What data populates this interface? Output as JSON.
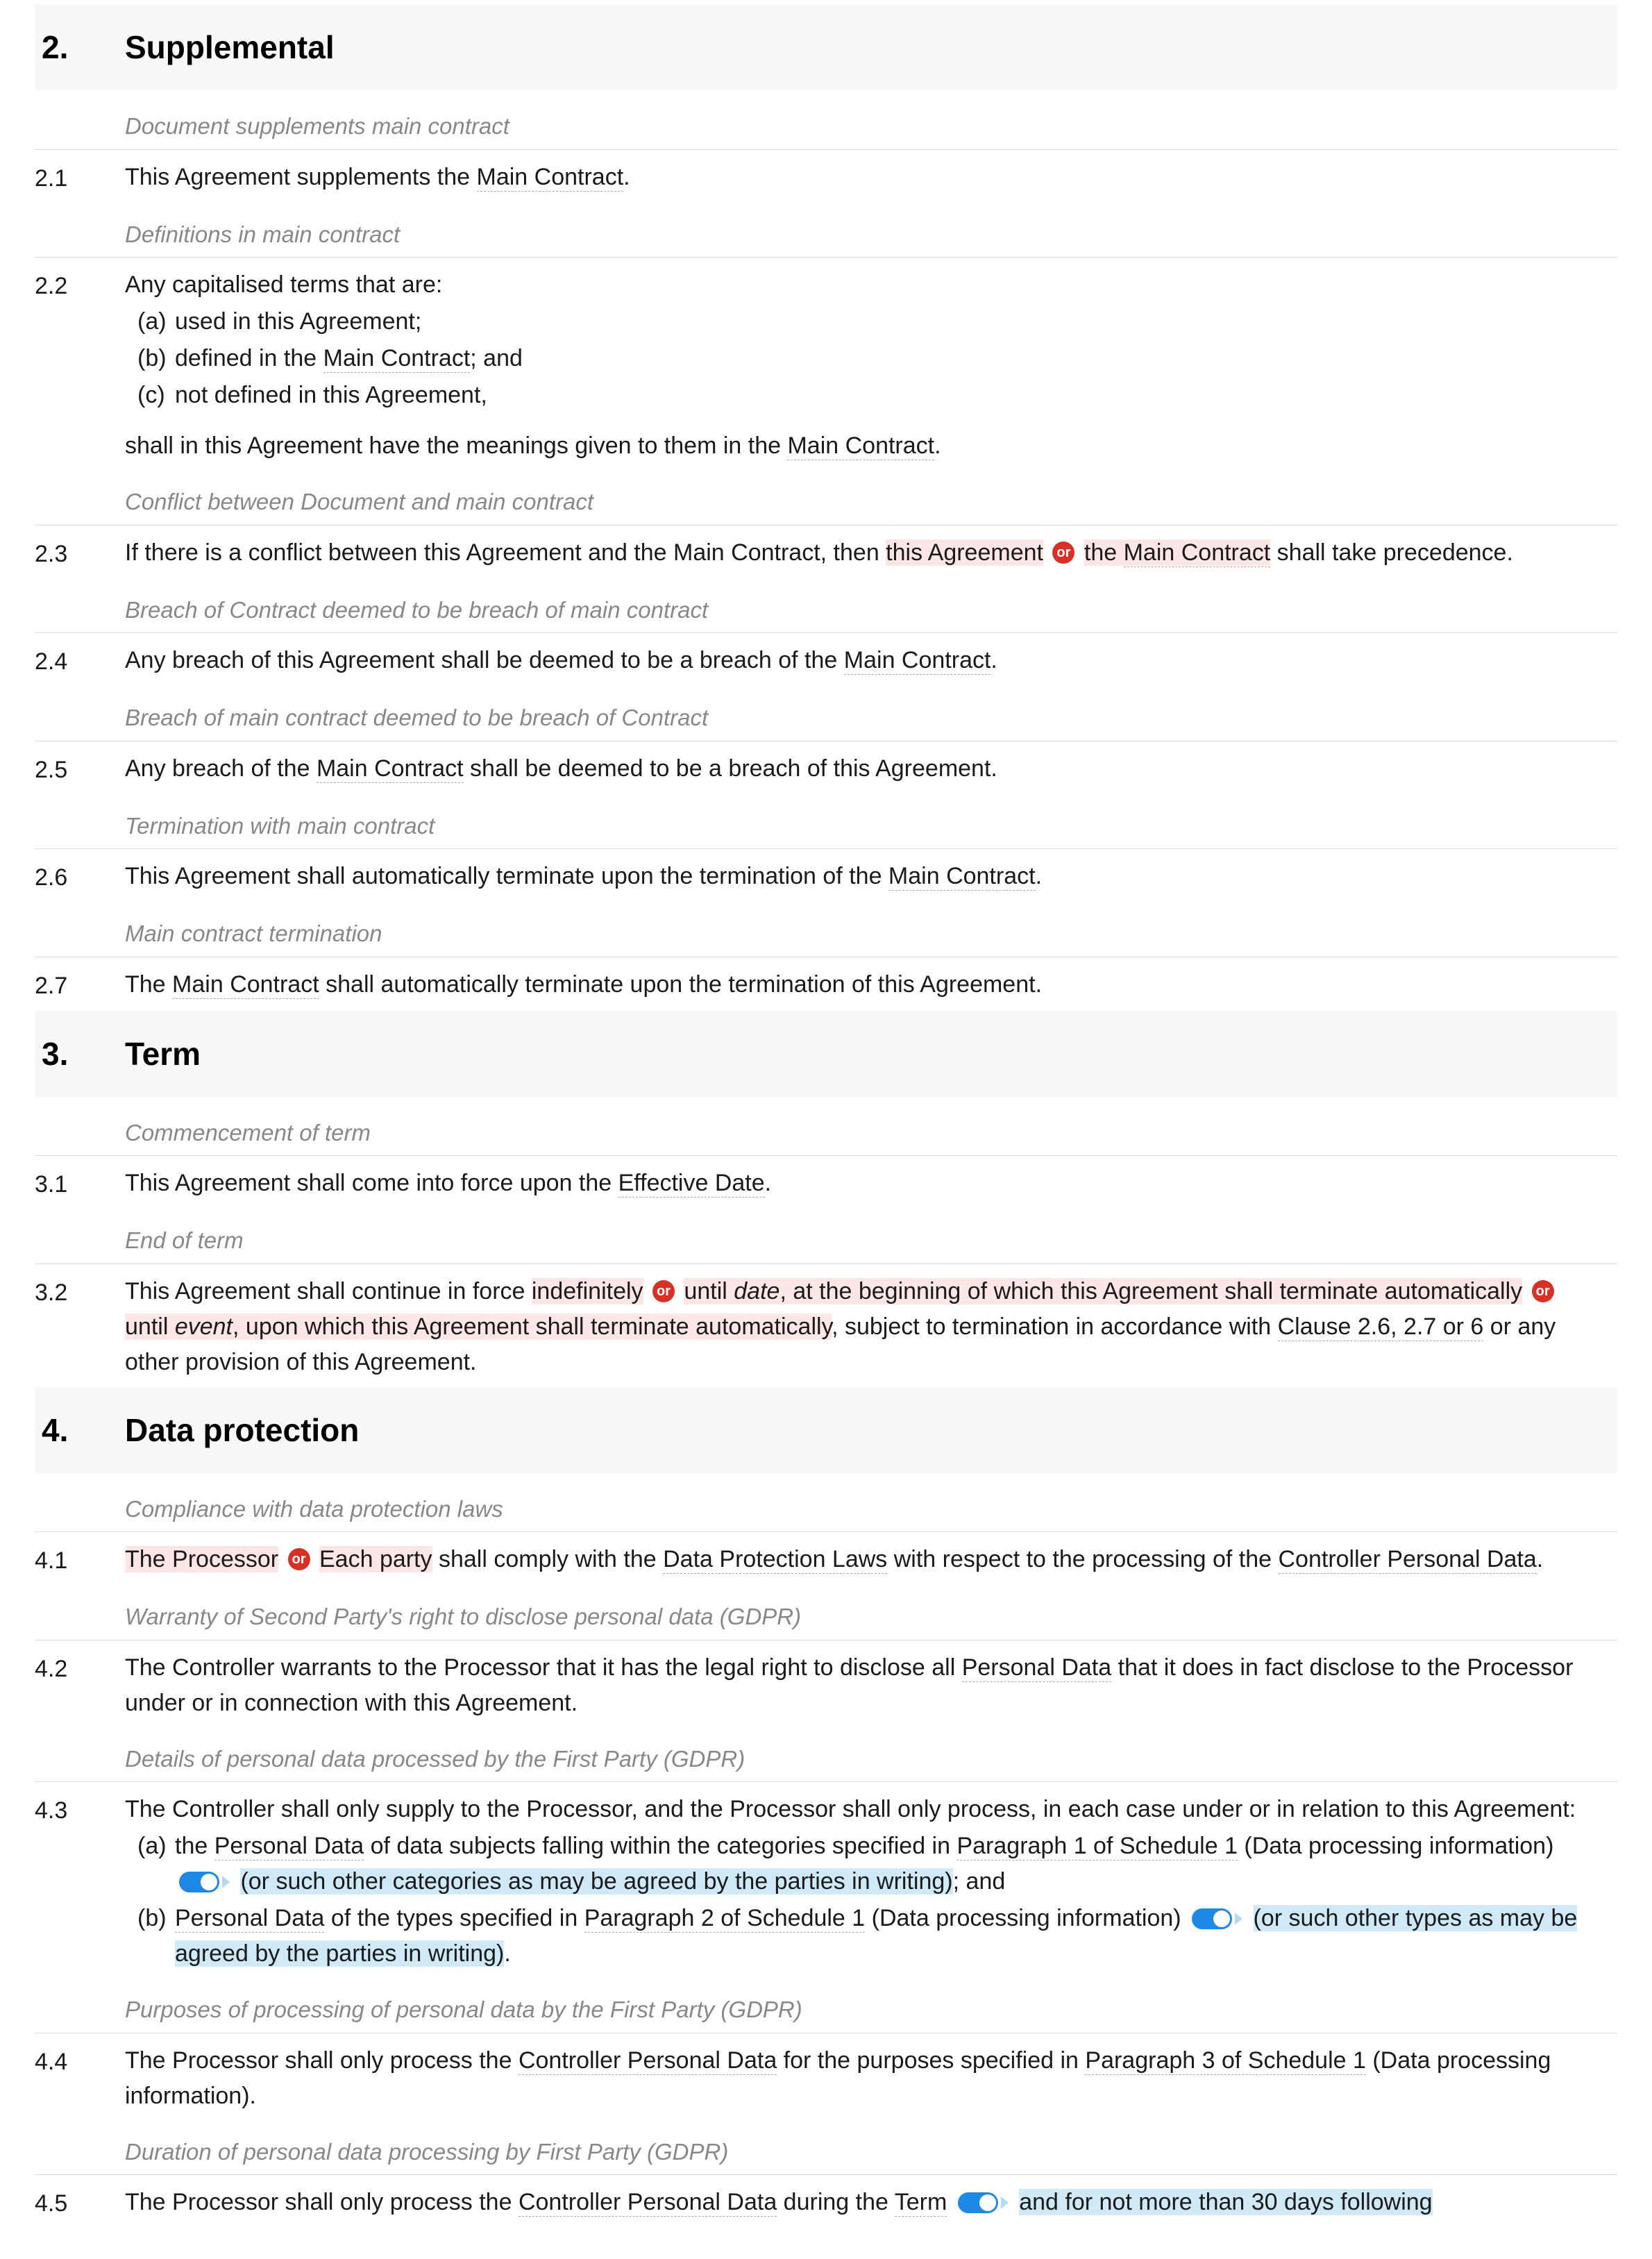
{
  "sections": {
    "s2": {
      "num": "2.",
      "title": "Supplemental"
    },
    "s3": {
      "num": "3.",
      "title": "Term"
    },
    "s4": {
      "num": "4.",
      "title": "Data protection"
    }
  },
  "captions": {
    "c21": "Document supplements main contract",
    "c22": "Definitions in main contract",
    "c23": "Conflict between Document and main contract",
    "c24": "Breach of Contract deemed to be breach of main contract",
    "c25": "Breach of main contract deemed to be breach of Contract",
    "c26": "Termination with main contract",
    "c27": "Main contract termination",
    "c31": "Commencement of term",
    "c32": "End of term",
    "c41": "Compliance with data protection laws",
    "c42": "Warranty of Second Party's right to disclose personal data (GDPR)",
    "c43": "Details of personal data processed by the First Party (GDPR)",
    "c44": "Purposes of processing of personal data by the First Party (GDPR)",
    "c45": "Duration of personal data processing by First Party (GDPR)"
  },
  "nums": {
    "n21": "2.1",
    "n22": "2.2",
    "n23": "2.3",
    "n24": "2.4",
    "n25": "2.5",
    "n26": "2.6",
    "n27": "2.7",
    "n31": "3.1",
    "n32": "3.2",
    "n41": "4.1",
    "n42": "4.2",
    "n43": "4.3",
    "n44": "4.4",
    "n45": "4.5"
  },
  "txt": {
    "or": "or",
    "t21_a": "This Agreement supplements the ",
    "t21_b": "Main Contract",
    "t21_c": ".",
    "t22_intro": "Any capitalised terms that are:",
    "t22_a_l": "(a)",
    "t22_a": "used in this Agreement;",
    "t22_b_l": "(b)",
    "t22_b_a": "defined in the ",
    "t22_b_b": "Main Contract",
    "t22_b_c": "; and",
    "t22_c_l": "(c)",
    "t22_c": "not defined in this Agreement,",
    "t22_tail_a": "shall in this Agreement have the meanings given to them in the ",
    "t22_tail_b": "Main Contract",
    "t22_tail_c": ".",
    "t23_a": "If there is a conflict between this Agreement and the Main Contract, then ",
    "t23_opt1": "this Agreement",
    "t23_opt2_a": "the ",
    "t23_opt2_b": "Main Contract",
    "t23_c": " shall take precedence.",
    "t24_a": "Any breach of this Agreement shall be deemed to be a breach of the ",
    "t24_b": "Main Contract",
    "t24_c": ".",
    "t25_a": "Any breach of the ",
    "t25_b": "Main Contract",
    "t25_c": " shall be deemed to be a breach of this Agreement.",
    "t26_a": "This Agreement shall automatically terminate upon the termination of the ",
    "t26_b": "Main Contract",
    "t26_c": ".",
    "t27_a": "The ",
    "t27_b": "Main Contract",
    "t27_c": " shall automatically terminate upon the termination of this Agreement.",
    "t31_a": "This Agreement shall come into force upon the ",
    "t31_b": "Effective Date",
    "t31_c": ".",
    "t32_a": "This Agreement shall continue in force ",
    "t32_opt1": "indefinitely",
    "t32_opt2_a": "until ",
    "t32_opt2_b": "date",
    "t32_opt2_c": ", at the beginning of which this Agreement shall terminate automatically",
    "t32_opt3_a": "until ",
    "t32_opt3_b": "event",
    "t32_opt3_c": ", upon which this Agreement shall terminate automatically",
    "t32_d": ", subject to termination in accordance with ",
    "t32_e": "Clause 2.6, 2.7 or 6",
    "t32_f": " or any other provision of this Agreement.",
    "t41_opt1": "The Processor",
    "t41_opt2": "Each party",
    "t41_a": " shall comply with the ",
    "t41_b": "Data Protection Laws",
    "t41_c": " with respect to the processing of the ",
    "t41_d": "Controller Personal Data",
    "t41_e": ".",
    "t42_a": "The Controller warrants to the Processor that it has the legal right to disclose all ",
    "t42_b": "Personal Data",
    "t42_c": " that it does in fact disclose to the Processor under or in connection with this Agreement.",
    "t43_intro": "The Controller shall only supply to the Processor, and the Processor shall only process, in each case under or in relation to this Agreement:",
    "t43_a_l": "(a)",
    "t43_a_a": "the ",
    "t43_a_b": "Personal Data",
    "t43_a_c": " of data subjects falling within the categories specified in ",
    "t43_a_d": "Paragraph 1 of Schedule 1",
    "t43_a_e": " (Data processing information)",
    "t43_a_opt": "(or such other categories as may be agreed by the parties in writing)",
    "t43_a_f": "; and",
    "t43_b_l": "(b)",
    "t43_b_a": "Personal Data",
    "t43_b_b": " of the types specified in ",
    "t43_b_c": "Paragraph 2 of Schedule 1",
    "t43_b_d": " (Data processing information)",
    "t43_b_opt": "(or such other types as may be agreed by the parties in writing)",
    "t43_b_e": ".",
    "t44_a": "The Processor shall only process the ",
    "t44_b": "Controller Personal Data",
    "t44_c": " for the purposes specified in ",
    "t44_d": "Paragraph 3 of Schedule 1",
    "t44_e": " (Data processing information).",
    "t45_a": "The Processor shall only process the ",
    "t45_b": "Controller Personal Data",
    "t45_c": " during the ",
    "t45_d": "Term",
    "t45_opt": "and for not more than 30 days following"
  }
}
